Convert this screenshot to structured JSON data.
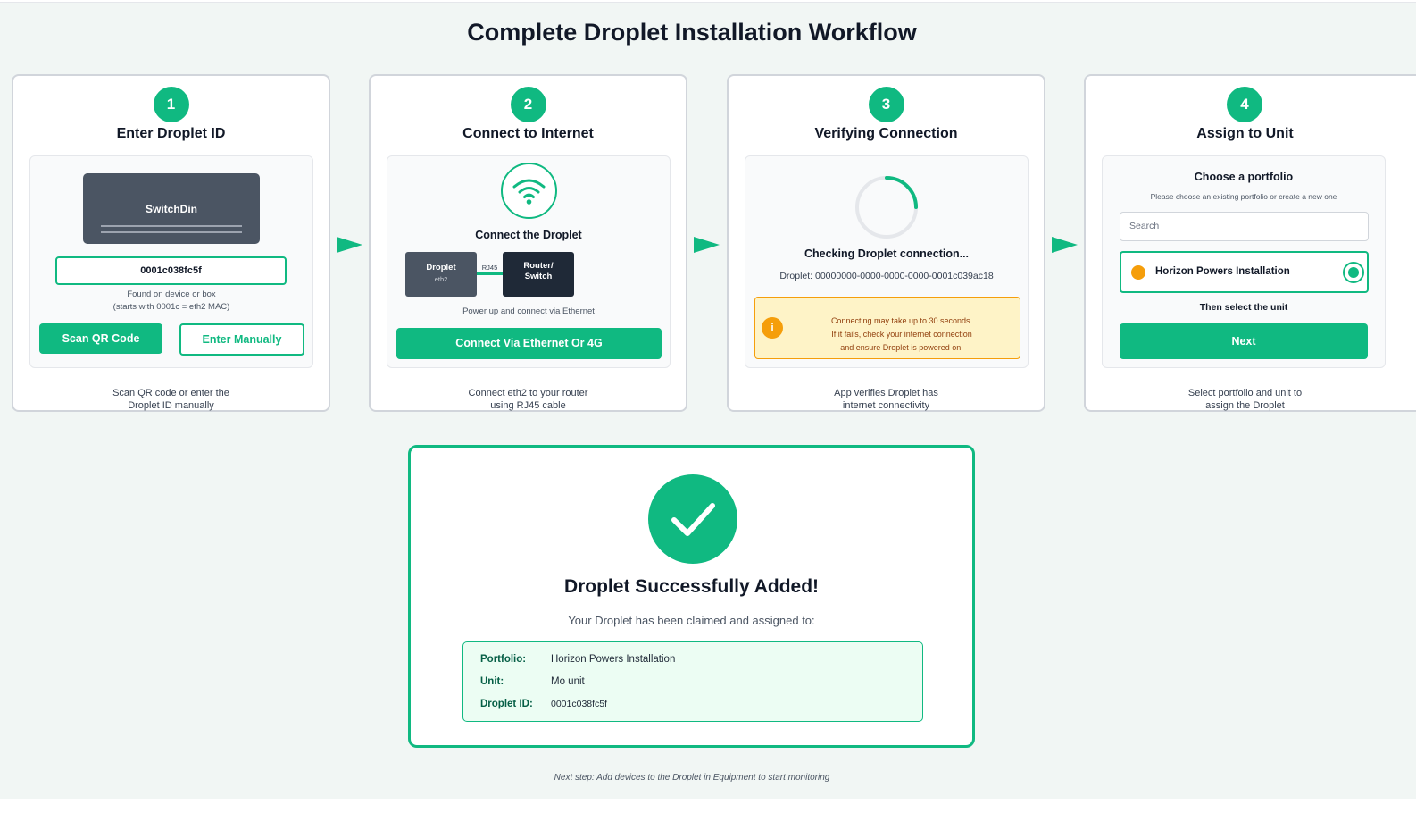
{
  "title": "Complete Droplet Installation Workflow",
  "colors": {
    "accent": "#10b981",
    "warning": "#f59e0b",
    "dark_device": "#4b5563"
  },
  "steps": [
    {
      "number": "1",
      "title": "Enter Droplet ID",
      "device_label": "SwitchDin",
      "droplet_id_value": "0001c038fc5f",
      "hint_line1": "Found on device or box",
      "hint_line2": "(starts with 0001c = eth2 MAC)",
      "scan_button": "Scan QR Code",
      "manual_button": "Enter Manually",
      "caption_line1": "Scan QR code or enter the",
      "caption_line2": "Droplet ID manually"
    },
    {
      "number": "2",
      "title": "Connect to Internet",
      "icon": "wifi-icon",
      "connect_title": "Connect the Droplet",
      "droplet_box": "Droplet",
      "droplet_port": "eth2",
      "cable_label": "RJ45",
      "router_line1": "Router/",
      "router_line2": "Switch",
      "power_hint": "Power up and connect via Ethernet",
      "connect_button": "Connect Via Ethernet Or 4G",
      "caption_line1": "Connect eth2 to your router",
      "caption_line2": "using RJ45 cable"
    },
    {
      "number": "3",
      "title": "Verifying Connection",
      "checking_text": "Checking Droplet connection...",
      "droplet_line": "Droplet: 00000000-0000-0000-0000-0001c039ac18",
      "warning_icon": "i",
      "warning_line1": "Connecting may take up to 30 seconds.",
      "warning_line2": "If it fails, check your internet connection",
      "warning_line3": "and ensure Droplet is powered on.",
      "caption_line1": "App verifies Droplet has",
      "caption_line2": "internet connectivity"
    },
    {
      "number": "4",
      "title": "Assign to Unit",
      "portfolio_title": "Choose a portfolio",
      "portfolio_sub": "Please choose an existing portfolio or create a new one",
      "search_placeholder": "Search",
      "option_label": "Horizon Powers Installation",
      "then_select": "Then select the unit",
      "next_button": "Next",
      "caption_line1": "Select portfolio and unit to",
      "caption_line2": "assign the Droplet"
    }
  ],
  "success": {
    "title": "Droplet Successfully Added!",
    "subtitle": "Your Droplet has been claimed and assigned to:",
    "portfolio_key": "Portfolio:",
    "portfolio_value": "Horizon Powers Installation",
    "unit_key": "Unit:",
    "unit_value": "Mo unit",
    "id_key": "Droplet ID:",
    "id_value": "0001c038fc5f"
  },
  "footer": "Next step: Add devices to the Droplet in Equipment to start monitoring"
}
